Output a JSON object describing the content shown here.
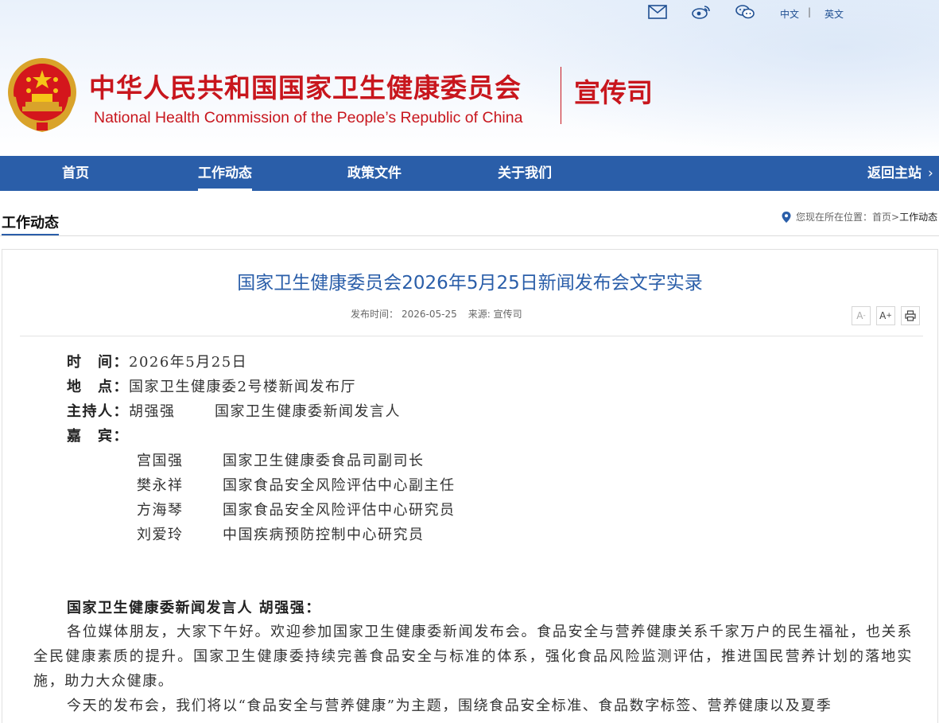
{
  "header": {
    "org_cn": "中华人民共和国国家卫生健康委员会",
    "org_en": "National Health Commission of the People’s  Republic of China",
    "dept": "宣传司",
    "lang_cn": "中文",
    "lang_sep": "|",
    "lang_en": "英文",
    "icons": [
      "mail-icon",
      "weibo-icon",
      "wechat-icon"
    ],
    "brand_red": "#c8161d"
  },
  "nav": {
    "items": [
      {
        "label": "首页"
      },
      {
        "label": "工作动态"
      },
      {
        "label": "政策文件"
      },
      {
        "label": "关于我们"
      }
    ],
    "active": "工作动态",
    "back_label": "返回主站",
    "back_chevron": "›",
    "bg_color": "#2a5ea9"
  },
  "section": {
    "title": "工作动态",
    "location_label": "您现在所在位置：",
    "crumb_home": "首页",
    "crumb_sep": ">",
    "crumb_current": "工作动态"
  },
  "article": {
    "title": "国家卫生健康委员会2026年5月25日新闻发布会文字实录",
    "publish_label": "发布时间：",
    "publish_date": "2026-05-25",
    "source_label": "来源: ",
    "source": "宣传司",
    "tools": {
      "font_small": "A",
      "font_large": "A",
      "print_icon": "print-icon"
    },
    "info": {
      "time_label": "时　间：",
      "time_value": "2026年5月25日",
      "place_label": "地　点：",
      "place_value": "国家卫生健康委2号楼新闻发布厅",
      "host_label": "主持人：",
      "host_name": "胡强强",
      "host_title": "国家卫生健康委新闻发言人",
      "guests_label": "嘉　宾："
    },
    "guests": [
      {
        "name": "宫国强",
        "title": "国家卫生健康委食品司副司长"
      },
      {
        "name": "樊永祥",
        "title": "国家食品安全风险评估中心副主任"
      },
      {
        "name": "方海琴",
        "title": "国家食品安全风险评估中心研究员"
      },
      {
        "name": "刘爱玲",
        "title": "中国疾病预防控制中心研究员"
      }
    ],
    "speaker": "国家卫生健康委新闻发言人 胡强强：",
    "paragraphs": [
      "各位媒体朋友，大家下午好。欢迎参加国家卫生健康委新闻发布会。食品安全与营养健康关系千家万户的民生福祉，也关系全民健康素质的提升。国家卫生健康委持续完善食品安全与标准的体系，强化食品风险监测评估，推进国民营养计划的落地实施，助力大众健康。",
      "今天的发布会，我们将以“食品安全与营养健康”为主题，围绕食品安全标准、食品数字标签、营养健康以及夏季"
    ]
  }
}
